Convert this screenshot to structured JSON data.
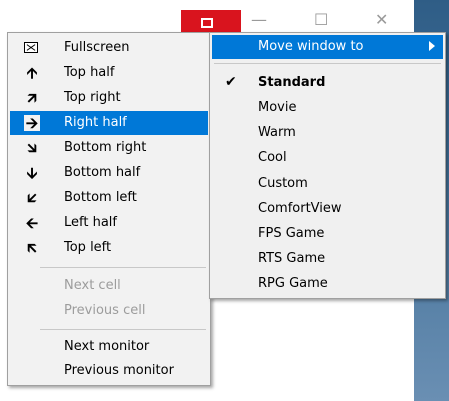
{
  "left_menu": {
    "items": [
      {
        "label": "Fullscreen",
        "icon": "fullscreen-icon",
        "glyph": ""
      },
      {
        "label": "Top half",
        "icon": "arrow-up-icon",
        "glyph": "🡩"
      },
      {
        "label": "Top right",
        "icon": "arrow-up-right-icon",
        "glyph": "🡭"
      },
      {
        "label": "Right half",
        "icon": "arrow-right-icon",
        "glyph": "🡪"
      },
      {
        "label": "Bottom right",
        "icon": "arrow-down-right-icon",
        "glyph": "🡮"
      },
      {
        "label": "Bottom half",
        "icon": "arrow-down-icon",
        "glyph": "🡫"
      },
      {
        "label": "Bottom left",
        "icon": "arrow-down-left-icon",
        "glyph": "🡯"
      },
      {
        "label": "Left half",
        "icon": "arrow-left-icon",
        "glyph": "🡨"
      },
      {
        "label": "Top left",
        "icon": "arrow-up-left-icon",
        "glyph": "🡬"
      }
    ],
    "cells": [
      {
        "label": "Next cell"
      },
      {
        "label": "Previous cell"
      }
    ],
    "monitors": [
      {
        "label": "Next monitor"
      },
      {
        "label": "Previous monitor"
      }
    ],
    "selected_label": "Right half"
  },
  "right_menu": {
    "header_label": "Move window to",
    "presets": [
      {
        "label": "Standard",
        "checked": true
      },
      {
        "label": "Movie"
      },
      {
        "label": "Warm"
      },
      {
        "label": "Cool"
      },
      {
        "label": "Custom"
      },
      {
        "label": "ComfortView"
      },
      {
        "label": "FPS Game"
      },
      {
        "label": "RTS Game"
      },
      {
        "label": "RPG Game"
      }
    ],
    "check_glyph": "✔"
  },
  "titlebar": {
    "minimize_glyph": "—",
    "maximize_glyph": "☐",
    "close_glyph": "✕"
  },
  "colors": {
    "highlight": "#0078d7",
    "close_red": "#d9141e",
    "menu_bg": "#f2f2f2"
  }
}
